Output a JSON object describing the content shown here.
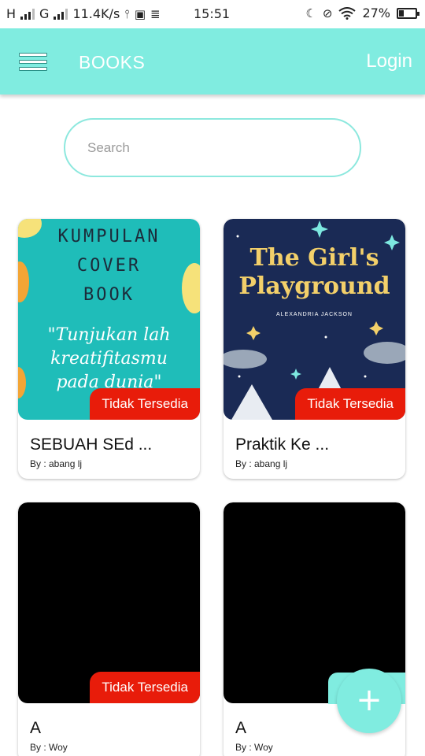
{
  "status_bar": {
    "carrier_1": "H",
    "carrier_2": "G",
    "network_speed": "11.4K/s",
    "time": "15:51",
    "battery_percent": "27%",
    "battery_level": 0.27,
    "icons": [
      "signal-icon",
      "usb-icon",
      "vpn-icon",
      "storage-icon",
      "moon-icon",
      "mute-icon",
      "wifi-icon",
      "battery-icon"
    ]
  },
  "header": {
    "menu_icon": "menu-icon",
    "title": "BOOKS",
    "login_label": "Login",
    "color": "#80ece0"
  },
  "search": {
    "placeholder": "Search",
    "value": ""
  },
  "books": [
    {
      "title": "SEBUAH SEd ...",
      "author": "By : abang lj",
      "status": "Tidak Tersedia",
      "cover_lines": [
        "KUMPULAN",
        "COVER",
        "BOOK"
      ],
      "cover_quote": [
        "\"Tunjukan lah",
        "kreatifitasmu",
        "pada dunia\""
      ]
    },
    {
      "title": "Praktik Ke ...",
      "author": "By : abang lj",
      "status": "Tidak Tersedia",
      "cover_lines": [
        "The Girl's",
        "Playground"
      ],
      "cover_author": "ALEXANDRIA JACKSON"
    },
    {
      "title": "A",
      "author": "By : Woy",
      "status": "Tidak Tersedia"
    },
    {
      "title": "A",
      "author": "By : Woy"
    }
  ],
  "fab": {
    "label": "+",
    "icon": "plus-icon"
  },
  "colors": {
    "accent": "#80ece0",
    "badge": "#e81c0a"
  }
}
